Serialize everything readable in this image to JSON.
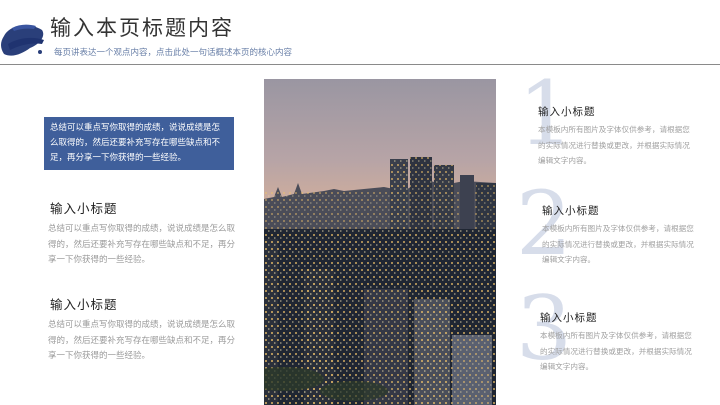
{
  "header": {
    "title": "输入本页标题内容",
    "subtitle": "每页讲表达一个观点内容，点击此处一句话概述本页的核心内容"
  },
  "left": {
    "highlight": "总结可以重点写你取得的成绩，说说成绩是怎么取得的，然后还要补充写存在哪些缺点和不足，再分享一下你获得的一些经验。",
    "items": [
      {
        "heading": "输入小标题",
        "body": "总结可以重点写你取得的成绩，说说成绩是怎么取得的，然后还要补充写存在哪些缺点和不足，再分享一下你获得的一些经验。"
      },
      {
        "heading": "输入小标题",
        "body": "总结可以重点写你取得的成绩，说说成绩是怎么取得的，然后还要补充写存在哪些缺点和不足，再分享一下你获得的一些经验。"
      }
    ]
  },
  "right": {
    "items": [
      {
        "number": "1",
        "heading": "输入小标题",
        "body": "本模板内所有图片及字体仅供参考，请根据您的实际情况进行替换或更改，并根据实际情况编辑文字内容。"
      },
      {
        "number": "2",
        "heading": "输入小标题",
        "body": "本模板内所有图片及字体仅供参考，请根据您的实际情况进行替换或更改，并根据实际情况编辑文字内容。"
      },
      {
        "number": "3",
        "heading": "输入小标题",
        "body": "本模板内所有图片及字体仅供参考，请根据您的实际情况进行替换或更改，并根据实际情况编辑文字内容。"
      }
    ]
  },
  "colors": {
    "accent": "#3f5f9b",
    "number": "#c2cbe0"
  },
  "icons": {
    "logo": "ink-brush-stroke-icon"
  }
}
